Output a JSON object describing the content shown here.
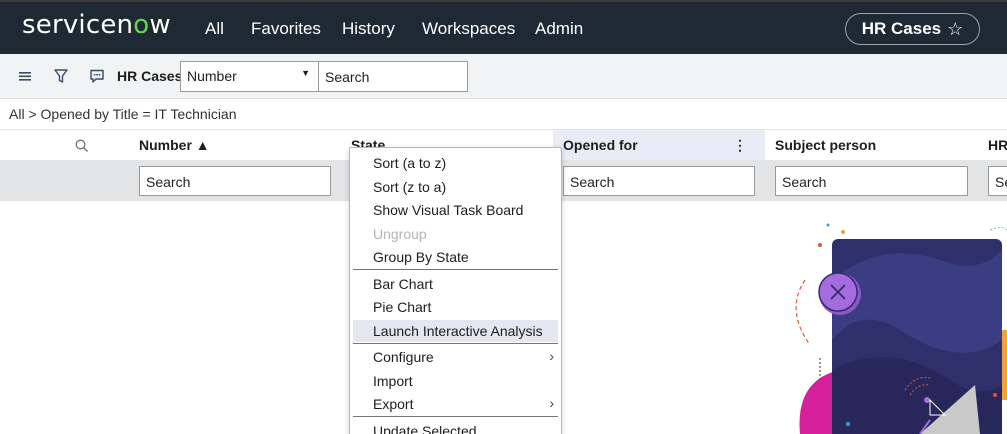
{
  "brand": {
    "logo_text_a": "servicen",
    "logo_text_o": "o",
    "logo_text_b": "w"
  },
  "nav": {
    "items": [
      "All",
      "Favorites",
      "History",
      "Workspaces",
      "Admin"
    ],
    "context_button": "HR Cases"
  },
  "toolbar": {
    "title": "HR Cases",
    "field_select": "Number",
    "search_placeholder": "Search"
  },
  "breadcrumb": "All > Opened by Title = IT Technician",
  "columns": [
    {
      "label": "Number ▲"
    },
    {
      "label": "State"
    },
    {
      "label": "Opened for"
    },
    {
      "label": "Subject person"
    },
    {
      "label": "HR"
    }
  ],
  "filters": {
    "number": "Search",
    "opened_for": "Search",
    "subject_person": "Search",
    "hr": "Se"
  },
  "menu": {
    "items": [
      {
        "label": "Sort (a to z)"
      },
      {
        "label": "Sort (z to a)"
      },
      {
        "label": "Show Visual Task Board"
      },
      {
        "label": "Ungroup"
      },
      {
        "label": "Group By State"
      },
      {
        "label": "Bar Chart"
      },
      {
        "label": "Pie Chart"
      },
      {
        "label": "Launch Interactive Analysis"
      },
      {
        "label": "Configure"
      },
      {
        "label": "Import"
      },
      {
        "label": "Export"
      },
      {
        "label": "Update Selected"
      }
    ]
  },
  "colors": {
    "nav_bg": "#1f2933",
    "logo_accent": "#62d84e",
    "active_column": "#e9ecf6",
    "menu_hover": "#e4e7f2",
    "illustration_panel": "#2f2f6b",
    "illustration_magenta": "#d61f9b",
    "illustration_purple": "#a56ce0"
  }
}
